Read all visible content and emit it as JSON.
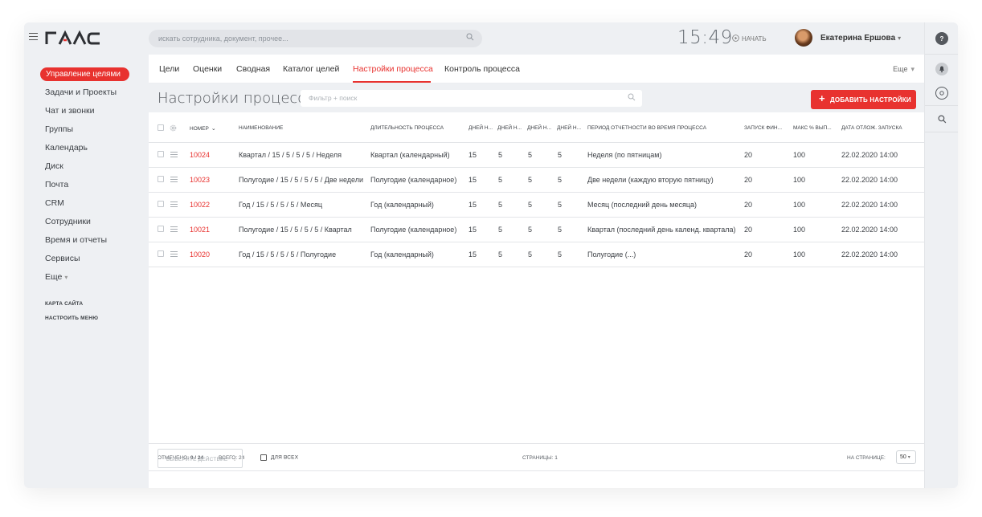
{
  "topbar": {
    "logo_text": "ГАЛС",
    "search_placeholder": "искать сотрудника, документ, прочее...",
    "clock": "15:49",
    "start_label": "НАЧАТЬ",
    "user_name": "Екатерина Ершова"
  },
  "sidebar": {
    "active_item": "Управление целями",
    "items": [
      "Задачи и Проекты",
      "Чат и звонки",
      "Группы",
      "Календарь",
      "Диск",
      "Почта",
      "CRM",
      "Сотрудники",
      "Время и отчеты",
      "Сервисы"
    ],
    "more": "Еще",
    "sitemap": "КАРТА САЙТА",
    "configure_menu": "НАСТРОИТЬ МЕНЮ"
  },
  "tabs": {
    "items": [
      "Цели",
      "Оценки",
      "Сводная",
      "Каталог целей",
      "Настройки процесса",
      "Контроль процесса"
    ],
    "active_index": 4,
    "more": "Еще"
  },
  "page": {
    "title": "Настройки процесса",
    "filter_placeholder": "Фильтр + поиск",
    "add_button": "ДОБАВИТЬ НАСТРОЙКИ"
  },
  "table": {
    "columns": [
      "НОМЕР",
      "НАИМЕНОВАНИЕ",
      "ДЛИТЕЛЬНОСТЬ ПРОЦЕССА",
      "ДНЕЙ Н...",
      "ДНЕЙ Н...",
      "ДНЕЙ Н...",
      "ДНЕЙ Н...",
      "ПЕРИОД ОТЧЕТНОСТИ ВО ВРЕМЯ ПРОЦЕССА",
      "ЗАПУСК ФИН...",
      "МАКС % ВЫП...",
      "ДАТА ОТЛОЖ. ЗАПУСКА"
    ],
    "rows": [
      [
        "10024",
        "Квартал / 15 / 5 / 5 / 5 / Неделя",
        "Квартал (календарный)",
        "15",
        "5",
        "5",
        "5",
        "Неделя (по пятницам)",
        "20",
        "100",
        "22.02.2020 14:00"
      ],
      [
        "10023",
        "Полугодие / 15 / 5 / 5 / 5 / Две недели",
        "Полугодие (календарное)",
        "15",
        "5",
        "5",
        "5",
        "Две недели (каждую вторую пятницу)",
        "20",
        "100",
        "22.02.2020 14:00"
      ],
      [
        "10022",
        "Год / 15 / 5 / 5 / 5 / Месяц",
        "Год (календарный)",
        "15",
        "5",
        "5",
        "5",
        "Месяц (последний день месяца)",
        "20",
        "100",
        "22.02.2020 14:00"
      ],
      [
        "10021",
        "Полугодие / 15 / 5 / 5 / 5 / Квартал",
        "Полугодие (календарное)",
        "15",
        "5",
        "5",
        "5",
        "Квартал (последний день календ. квартала)",
        "20",
        "100",
        "22.02.2020 14:00"
      ],
      [
        "10020",
        "Год / 15 / 5 / 5 / 5 / Полугодие",
        "Год (календарный)",
        "15",
        "5",
        "5",
        "5",
        "Полугодие (...)",
        "20",
        "100",
        "22.02.2020 14:00"
      ]
    ]
  },
  "footer": {
    "selected_label": "ОТМЕЧЕНО:",
    "selected_value": "0 / 24",
    "total_label": "ВСЕГО: 24",
    "pages_label": "СТРАНИЦЫ: 1",
    "per_page_label": "НА СТРАНИЦЕ:",
    "per_page_value": "50",
    "action_select": "ВЫБЕРИТЕ ДЕЙСТВИЕ",
    "for_all": "ДЛЯ ВСЕХ"
  },
  "colors": {
    "accent": "#e8322f",
    "background": "#eef0f3"
  }
}
